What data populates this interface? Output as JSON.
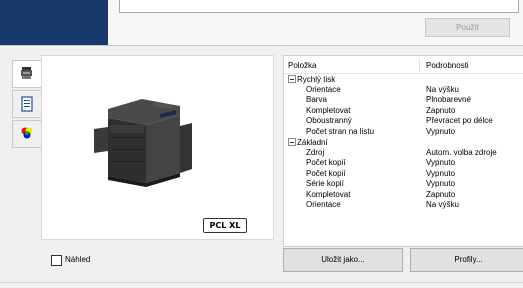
{
  "top": {
    "apply_label": "Použít"
  },
  "colors": {
    "brand": "#17386b",
    "selection_bg": "#ffffff"
  },
  "tabs": [
    {
      "icon": "printer-settings-icon"
    },
    {
      "icon": "document-icon"
    },
    {
      "icon": "color-wheel-icon"
    }
  ],
  "preview": {
    "badge": "PCL XL",
    "checkbox_label": "Náhled",
    "checked": false
  },
  "settings_table": {
    "columns": [
      "Položka",
      "Podrobnosti"
    ],
    "rows": [
      {
        "label": "Rychlý tisk",
        "value": "",
        "group": true
      },
      {
        "label": "Orientace",
        "value": "Na výšku"
      },
      {
        "label": "Barva",
        "value": "Plnobarevné"
      },
      {
        "label": "Kompletovat",
        "value": "Zapnuto"
      },
      {
        "label": "Oboustranný",
        "value": "Převracet po délce"
      },
      {
        "label": "Počet stran na listu",
        "value": "Vypnuto"
      },
      {
        "label": "Základní",
        "value": "",
        "group": true
      },
      {
        "label": "Zdroj",
        "value": "Autom. volba zdroje"
      },
      {
        "label": "Počet kopií",
        "value": "Vypnuto"
      },
      {
        "label": "Počet kopií",
        "value": "Vypnuto"
      },
      {
        "label": "Série kopií",
        "value": "Vypnuto"
      },
      {
        "label": "Kompletovat",
        "value": "Zapnuto"
      },
      {
        "label": "Orientace",
        "value": "Na výšku"
      }
    ]
  },
  "buttons": {
    "save": "Uložit jako...",
    "profiles": "Profily..."
  }
}
